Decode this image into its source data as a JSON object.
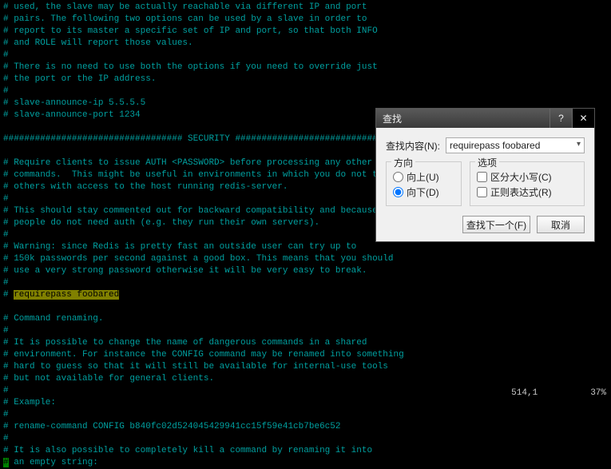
{
  "editor_lines": [
    {
      "t": "# used, the slave may be actually reachable via different IP and port"
    },
    {
      "t": "# pairs. The following two options can be used by a slave in order to"
    },
    {
      "t": "# report to its master a specific set of IP and port, so that both INFO"
    },
    {
      "t": "# and ROLE will report those values."
    },
    {
      "t": "#"
    },
    {
      "t": "# There is no need to use both the options if you need to override just"
    },
    {
      "t": "# the port or the IP address."
    },
    {
      "t": "#"
    },
    {
      "t": "# slave-announce-ip 5.5.5.5"
    },
    {
      "t": "# slave-announce-port 1234"
    },
    {
      "t": ""
    },
    {
      "t": "################################## SECURITY ###################################"
    },
    {
      "t": ""
    },
    {
      "t": "# Require clients to issue AUTH <PASSWORD> before processing any other"
    },
    {
      "t": "# commands.  This might be useful in environments in which you do not trust"
    },
    {
      "t": "# others with access to the host running redis-server."
    },
    {
      "t": "#"
    },
    {
      "t": "# This should stay commented out for backward compatibility and because most"
    },
    {
      "t": "# people do not need auth (e.g. they run their own servers)."
    },
    {
      "t": "#"
    },
    {
      "t": "# Warning: since Redis is pretty fast an outside user can try up to"
    },
    {
      "t": "# 150k passwords per second against a good box. This means that you should"
    },
    {
      "t": "# use a very strong password otherwise it will be very easy to break."
    },
    {
      "t": "#"
    },
    {
      "t": "# ",
      "hl": "requirepass foobared"
    },
    {
      "t": ""
    },
    {
      "t": "# Command renaming."
    },
    {
      "t": "#"
    },
    {
      "t": "# It is possible to change the name of dangerous commands in a shared"
    },
    {
      "t": "# environment. For instance the CONFIG command may be renamed into something"
    },
    {
      "t": "# hard to guess so that it will still be available for internal-use tools"
    },
    {
      "t": "# but not available for general clients."
    },
    {
      "t": "#"
    },
    {
      "t": "# Example:"
    },
    {
      "t": "#"
    },
    {
      "t": "# rename-command CONFIG b840fc02d524045429941cc15f59e41cb7be6c52"
    },
    {
      "t": "#"
    },
    {
      "t": "# It is also possible to completely kill a command by renaming it into"
    },
    {
      "t": "",
      "cursor": true,
      "cursortxt": "#",
      "rest": " an empty string:"
    }
  ],
  "status": "514,1          37%",
  "dialog": {
    "title": "查找",
    "help": "?",
    "close": "✕",
    "search_label": "查找内容(N):",
    "search_value": "requirepass foobared",
    "direction_title": "方向",
    "up_label": "向上(U)",
    "down_label": "向下(D)",
    "options_title": "选项",
    "case_label": "区分大小写(C)",
    "regex_label": "正则表达式(R)",
    "find_next": "查找下一个(F)",
    "cancel": "取消"
  }
}
